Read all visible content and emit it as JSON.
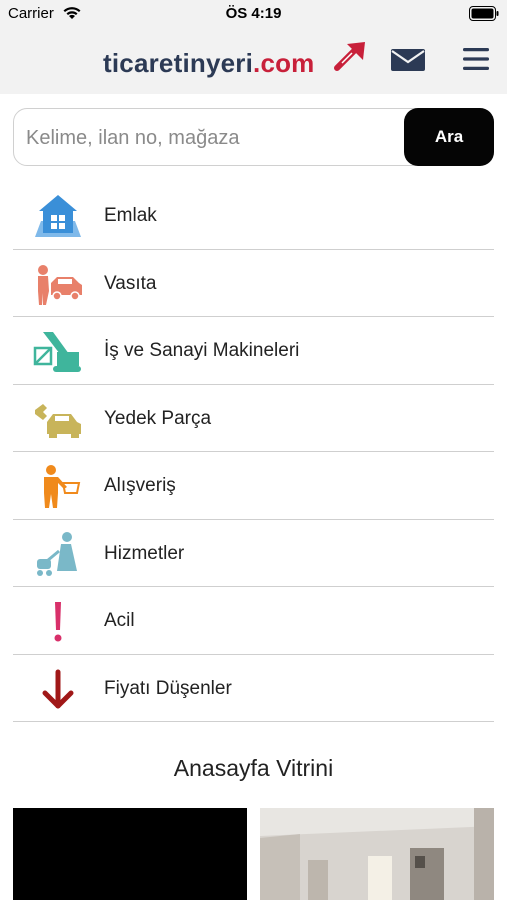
{
  "status": {
    "carrier": "Carrier",
    "time": "ÖS 4:19"
  },
  "header": {
    "logo_main": "ticaretinyeri",
    "logo_tld": ".com",
    "icons": [
      "logo-arrow-icon",
      "mail-icon",
      "hamburger-menu-icon"
    ]
  },
  "search": {
    "placeholder": "Kelime, ilan no, mağaza",
    "button_label": "Ara"
  },
  "categories": [
    {
      "label": "Emlak",
      "icon": "house-icon",
      "color": "#3a8fd8"
    },
    {
      "label": "Vasıta",
      "icon": "car-icon",
      "color": "#e8806a"
    },
    {
      "label": "İş ve Sanayi Makineleri",
      "icon": "excavator-icon",
      "color": "#3fb59c"
    },
    {
      "label": "Yedek Parça",
      "icon": "spare-part-icon",
      "color": "#c8b45a"
    },
    {
      "label": "Alışveriş",
      "icon": "shopping-icon",
      "color": "#f08a1c"
    },
    {
      "label": "Hizmetler",
      "icon": "services-icon",
      "color": "#7ab8c8"
    },
    {
      "label": "Acil",
      "icon": "exclamation-icon",
      "color": "#d8306a"
    },
    {
      "label": "Fiyatı Düşenler",
      "icon": "down-arrow-icon",
      "color": "#a01818"
    }
  ],
  "showcase": {
    "title": "Anasayfa Vitrini"
  },
  "colors": {
    "header_bg": "#f2f2f2",
    "brand_navy": "#2c3a55",
    "brand_red": "#c8203a"
  }
}
